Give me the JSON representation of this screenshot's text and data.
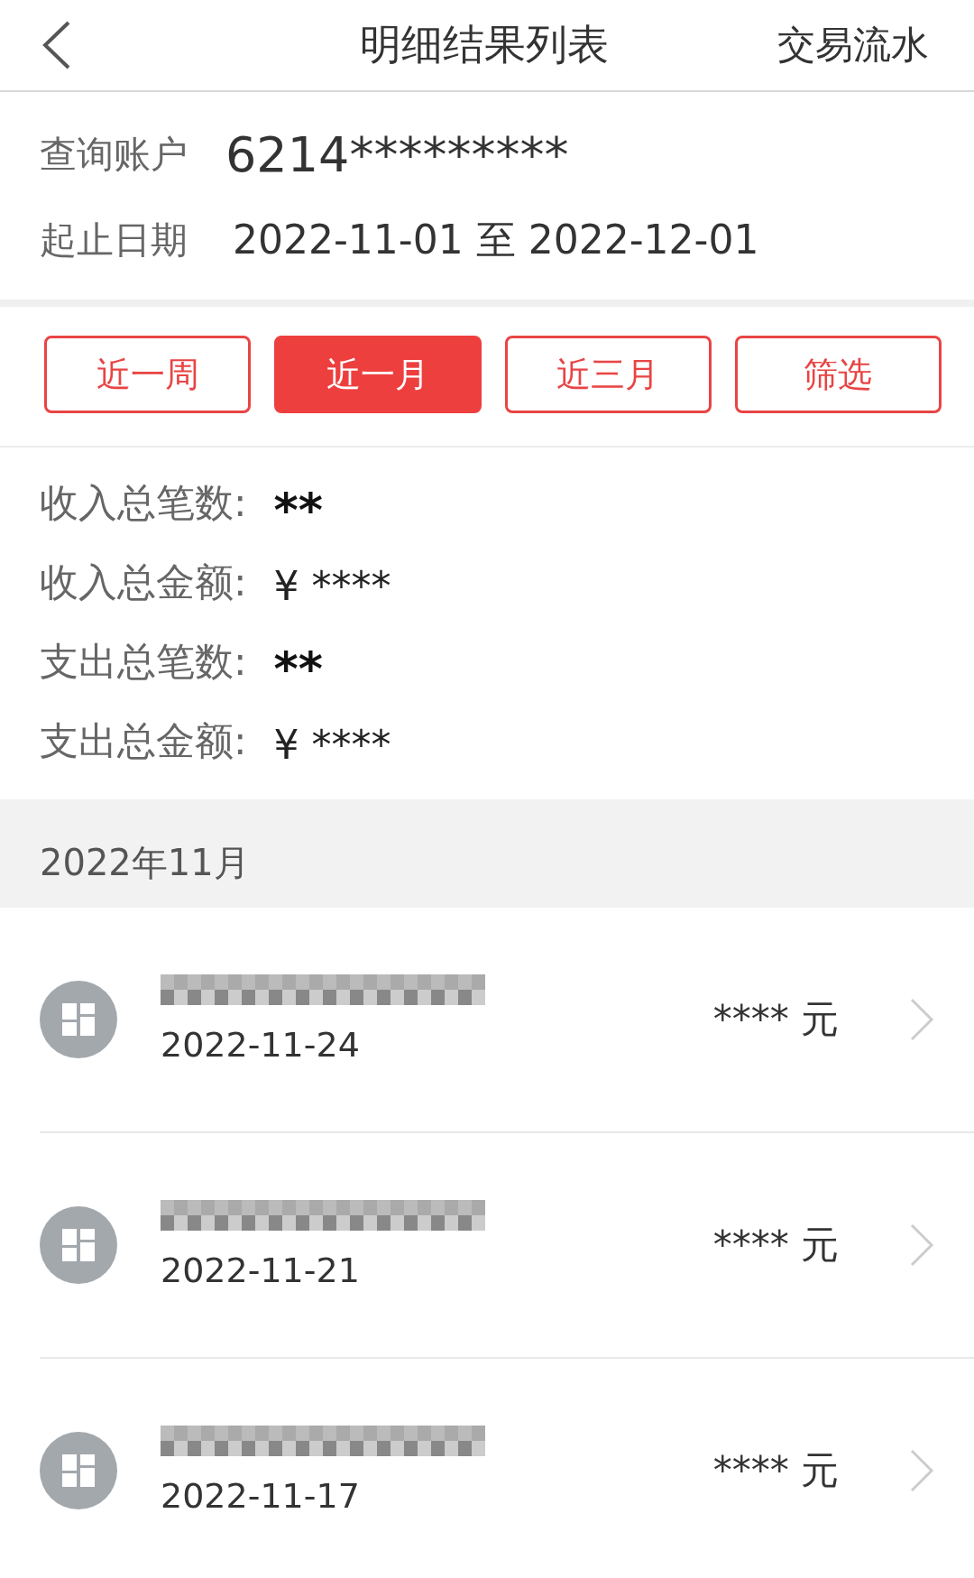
{
  "header": {
    "title": "明细结果列表",
    "action": "交易流水"
  },
  "account": {
    "label": "查询账户",
    "value": "6214*********"
  },
  "dates": {
    "label": "起止日期",
    "value": "2022-11-01 至 2022-12-01"
  },
  "periods": [
    {
      "label": "近一周",
      "selected": false
    },
    {
      "label": "近一月",
      "selected": true
    },
    {
      "label": "近三月",
      "selected": false
    },
    {
      "label": "筛选",
      "selected": false
    }
  ],
  "summary": [
    {
      "label": "收入总笔数:",
      "value": "**",
      "kind": "count"
    },
    {
      "label": "收入总金额:",
      "value": "¥ ****",
      "kind": "amount"
    },
    {
      "label": "支出总笔数:",
      "value": "**",
      "kind": "count"
    },
    {
      "label": "支出总金额:",
      "value": "¥ ****",
      "kind": "amount"
    }
  ],
  "month": "2022年11月",
  "transactions": [
    {
      "date": "2022-11-24",
      "amount": "**** 元"
    },
    {
      "date": "2022-11-21",
      "amount": "**** 元"
    },
    {
      "date": "2022-11-17",
      "amount": "**** 元"
    }
  ]
}
